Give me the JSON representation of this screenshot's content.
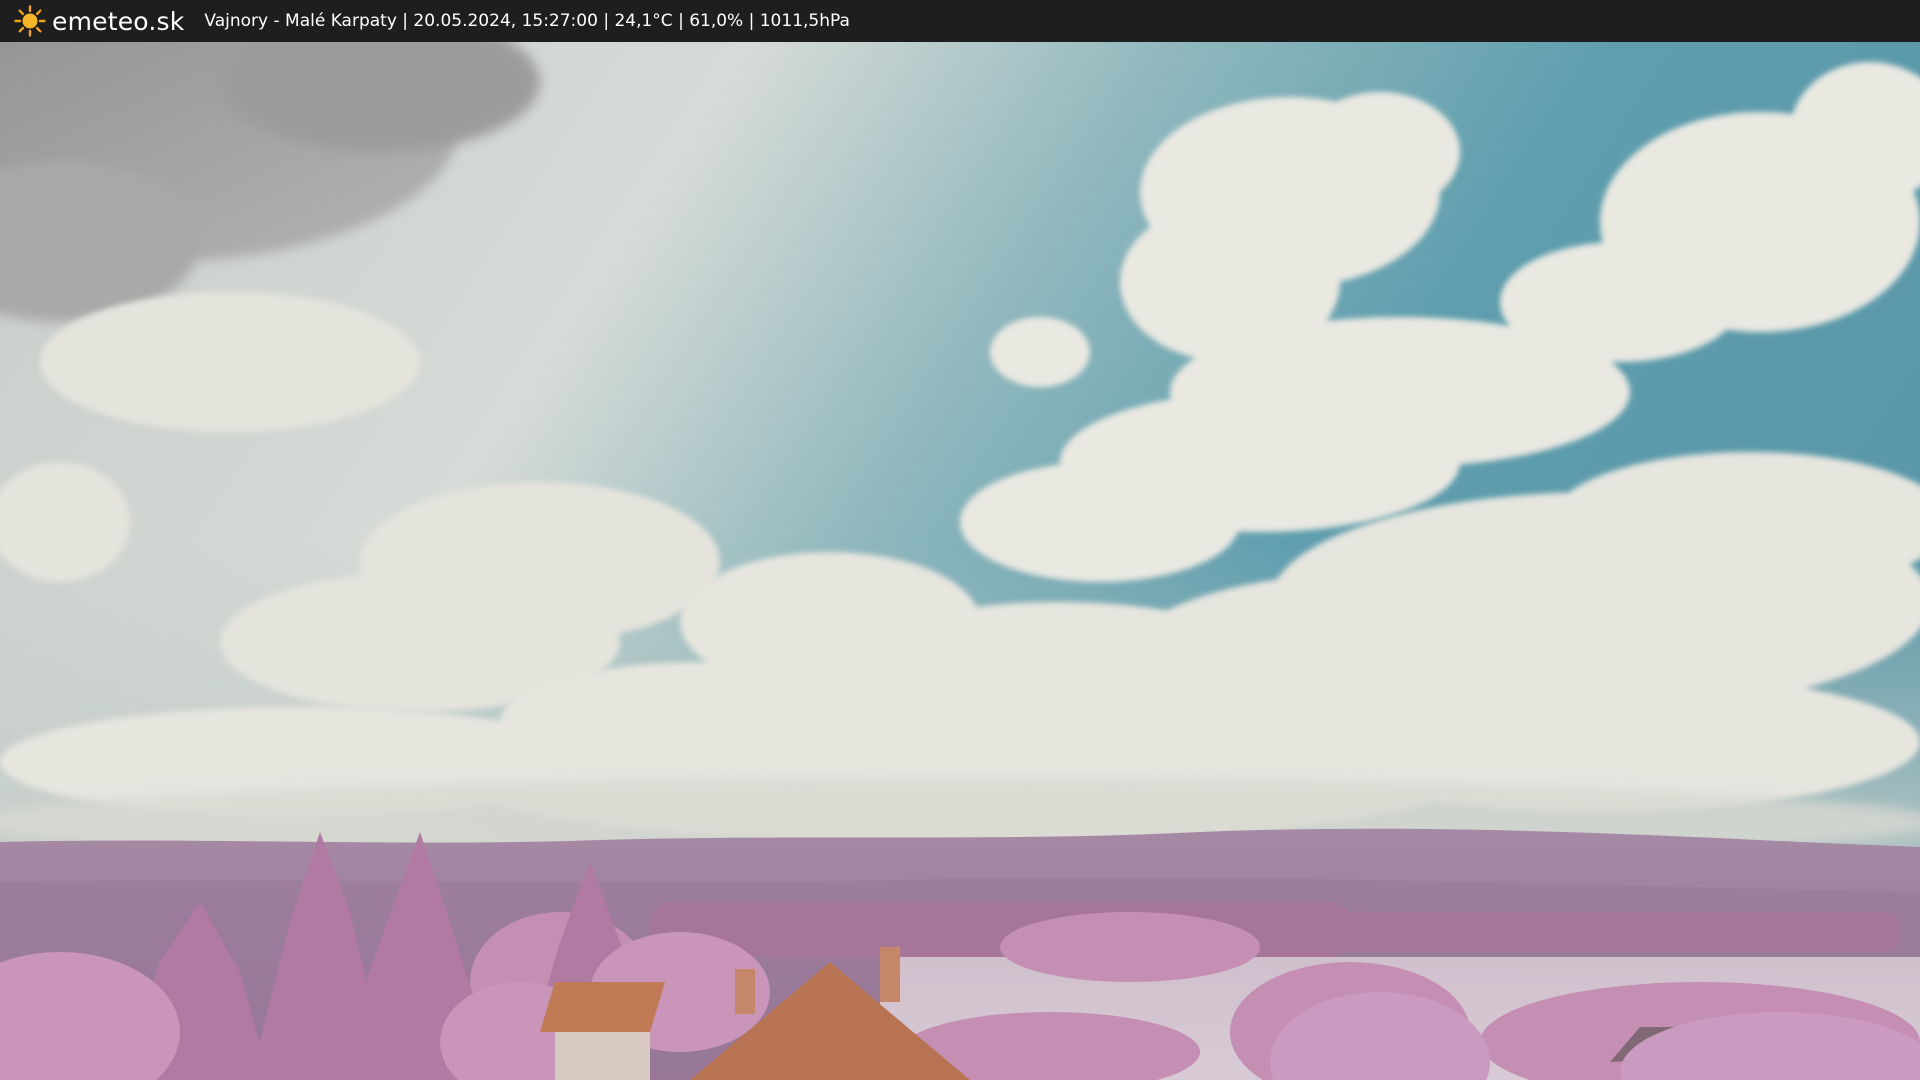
{
  "header": {
    "logo_icon": "sun-icon",
    "brand": "emeteo.sk",
    "info": "Vajnory - Malé Karpaty | 20.05.2024, 15:27:00 | 24,1°C | 61,0% | 1011,5hPa"
  },
  "colors": {
    "bar_background": "#1e1e1e",
    "sun": "#f2a21d",
    "sky_blue": "#5f9eae",
    "cloud": "#e8e7df",
    "vegetation": "#c58fb3",
    "hills": "#9a7a98",
    "roof": "#c07a55"
  }
}
